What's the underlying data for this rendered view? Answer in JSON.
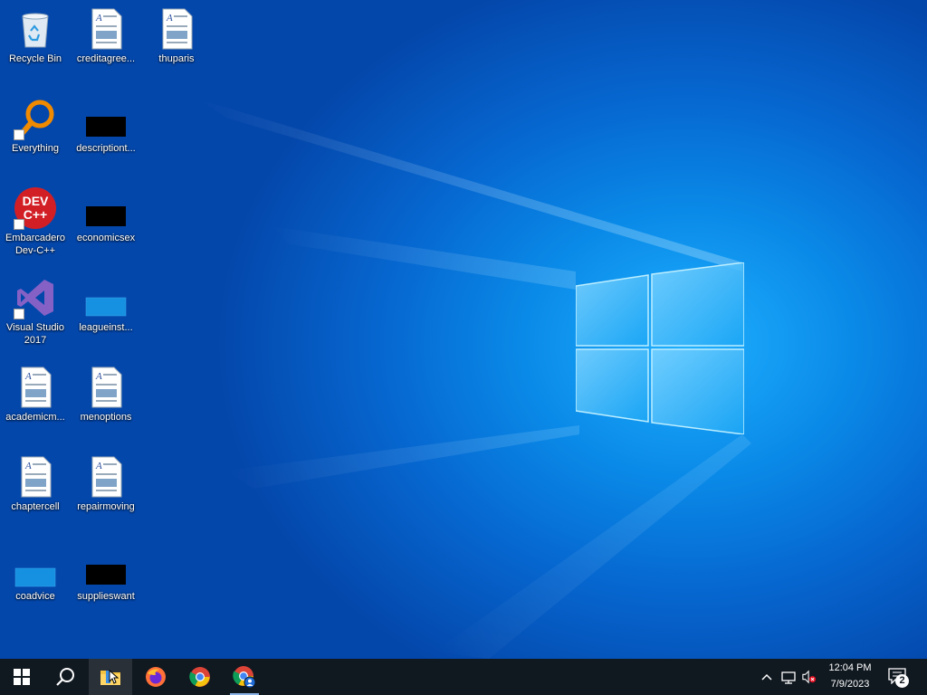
{
  "desktop": {
    "icons": [
      {
        "id": "recycle-bin",
        "label": "Recycle Bin",
        "type": "recycle-bin-icon"
      },
      {
        "id": "creditagree",
        "label": "creditagree...",
        "type": "document-icon"
      },
      {
        "id": "thuparis",
        "label": "thuparis",
        "type": "document-icon"
      },
      {
        "id": "everything",
        "label": "Everything",
        "type": "everything-search-icon"
      },
      {
        "id": "descriptiont",
        "label": "descriptiont...",
        "type": "black-file-icon"
      },
      {
        "id": "devcpp",
        "label": "Embarcadero Dev-C++",
        "type": "devcpp-icon"
      },
      {
        "id": "economicsex",
        "label": "economicsex",
        "type": "black-file-icon"
      },
      {
        "id": "visualstudio",
        "label": "Visual Studio 2017",
        "type": "visual-studio-icon"
      },
      {
        "id": "leagueinst",
        "label": "leagueinst...",
        "type": "blank-file-icon"
      },
      {
        "id": "academicm",
        "label": "academicm...",
        "type": "document-icon"
      },
      {
        "id": "menoptions",
        "label": "menoptions",
        "type": "document-icon"
      },
      {
        "id": "chaptercell",
        "label": "chaptercell",
        "type": "document-icon"
      },
      {
        "id": "repairmoving",
        "label": "repairmoving",
        "type": "document-icon"
      },
      {
        "id": "coadvice",
        "label": "coadvice",
        "type": "blank-file-icon"
      },
      {
        "id": "supplieswant",
        "label": "supplieswant",
        "type": "black-file-icon"
      }
    ]
  },
  "taskbar": {
    "buttons": [
      {
        "name": "start-button",
        "icon": "windows-logo-icon"
      },
      {
        "name": "search-button",
        "icon": "search-icon"
      },
      {
        "name": "file-explorer-button",
        "icon": "folder-icon"
      },
      {
        "name": "firefox-button",
        "icon": "firefox-icon"
      },
      {
        "name": "chrome-button",
        "icon": "chrome-icon"
      },
      {
        "name": "chrome-profile-button",
        "icon": "chrome-profile-icon"
      }
    ],
    "tray": {
      "time": "12:04 PM",
      "date": "7/9/2023",
      "notification_count": "2"
    }
  },
  "colors": {
    "taskbar_bg": "#101820",
    "desktop_accent": "#0a8ae8"
  }
}
